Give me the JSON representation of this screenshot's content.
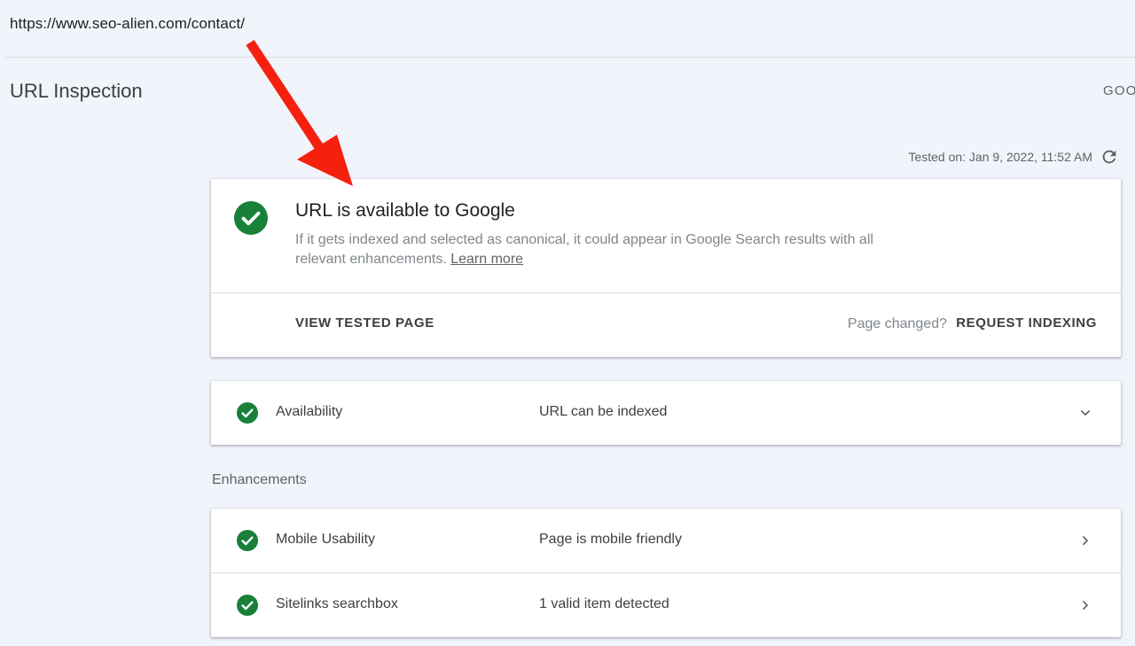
{
  "address_bar": {
    "url": "https://www.seo-alien.com/contact/"
  },
  "header": {
    "title": "URL Inspection",
    "top_right_link": "GOOGLE INDEX"
  },
  "test_info": {
    "tested_on": "Tested on: Jan 9, 2022, 11:52 AM"
  },
  "status_card": {
    "heading": "URL is available to Google",
    "description": "If it gets indexed and selected as canonical, it could appear in Google Search results with all relevant enhancements.",
    "learn_more": "Learn more",
    "view_tested_page": "VIEW TESTED PAGE",
    "page_changed": "Page changed?",
    "request_indexing": "REQUEST INDEXING"
  },
  "availability": {
    "label": "Availability",
    "value": "URL can be indexed"
  },
  "enhancements": {
    "section_label": "Enhancements",
    "items": [
      {
        "label": "Mobile Usability",
        "value": "Page is mobile friendly"
      },
      {
        "label": "Sitelinks searchbox",
        "value": "1 valid item detected"
      }
    ]
  },
  "colors": {
    "success_green": "#188038",
    "annotation_arrow": "#f5200d",
    "background": "#f1f4fb"
  },
  "icons": {
    "status": "check-circle-icon",
    "refresh": "refresh-icon",
    "expand": "chevron-down-icon",
    "open": "chevron-right-icon"
  }
}
